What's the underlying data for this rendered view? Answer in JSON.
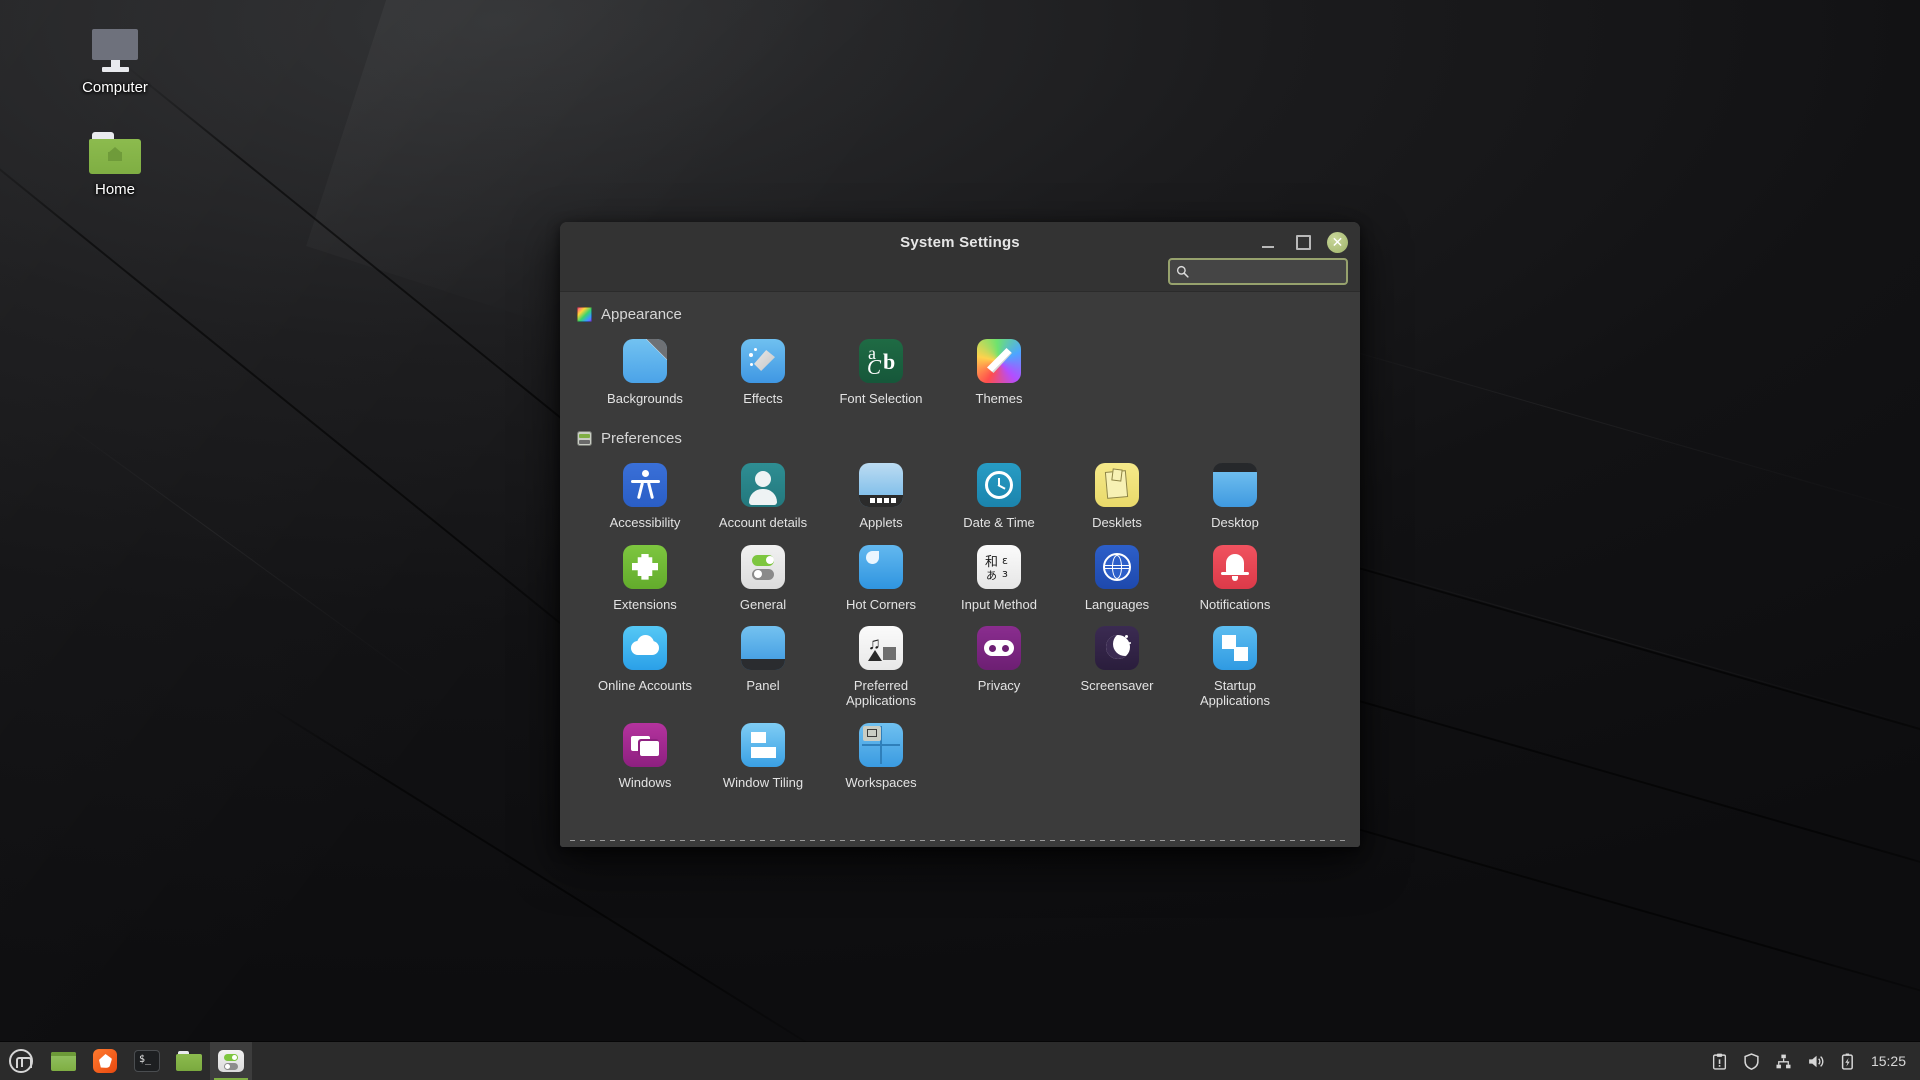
{
  "desktop": {
    "icons": [
      {
        "label": "Computer",
        "icon": "computer-monitor-icon"
      },
      {
        "label": "Home",
        "icon": "home-folder-icon"
      }
    ]
  },
  "window": {
    "title": "System Settings",
    "controls": {
      "minimize": "–",
      "maximize": "□",
      "close": "✕"
    },
    "search": {
      "value": "",
      "placeholder": "",
      "search_icon": "magnifier-icon",
      "clear_icon": "clear-backspace-icon"
    }
  },
  "sections": [
    {
      "id": "appearance",
      "title": "Appearance",
      "icon": "color-palette-icon",
      "items": [
        {
          "label": "Backgrounds",
          "icon": "backgrounds-icon",
          "tile": "t-bg"
        },
        {
          "label": "Effects",
          "icon": "magic-wand-icon",
          "tile": "t-fx"
        },
        {
          "label": "Font Selection",
          "icon": "font-abc-icon",
          "tile": "t-font"
        },
        {
          "label": "Themes",
          "icon": "paintbrush-icon",
          "tile": "t-theme"
        }
      ]
    },
    {
      "id": "preferences",
      "title": "Preferences",
      "icon": "sliders-panel-icon",
      "items": [
        {
          "label": "Accessibility",
          "icon": "accessibility-person-icon",
          "tile": "t-acc"
        },
        {
          "label": "Account details",
          "icon": "user-avatar-icon",
          "tile": "t-acct"
        },
        {
          "label": "Applets",
          "icon": "applets-panel-icon",
          "tile": "t-applets"
        },
        {
          "label": "Date & Time",
          "icon": "clock-icon",
          "tile": "t-clock"
        },
        {
          "label": "Desklets",
          "icon": "sticky-note-icon",
          "tile": "t-desk"
        },
        {
          "label": "Desktop",
          "icon": "desktop-screen-icon",
          "tile": "t-dtop"
        },
        {
          "label": "Extensions",
          "icon": "puzzle-piece-icon",
          "tile": "t-ext"
        },
        {
          "label": "General",
          "icon": "toggle-switches-icon",
          "tile": "t-gen"
        },
        {
          "label": "Hot Corners",
          "icon": "corner-icon",
          "tile": "t-hot"
        },
        {
          "label": "Input Method",
          "icon": "input-method-cjk-icon",
          "tile": "t-im"
        },
        {
          "label": "Languages",
          "icon": "globe-languages-icon",
          "tile": "t-lang"
        },
        {
          "label": "Notifications",
          "icon": "bell-icon",
          "tile": "t-note"
        },
        {
          "label": "Online Accounts",
          "icon": "cloud-icon",
          "tile": "t-cloud"
        },
        {
          "label": "Panel",
          "icon": "panel-bar-icon",
          "tile": "t-panel"
        },
        {
          "label": "Preferred Applications",
          "icon": "media-note-icon",
          "tile": "t-pref"
        },
        {
          "label": "Privacy",
          "icon": "mask-icon",
          "tile": "t-priv"
        },
        {
          "label": "Screensaver",
          "icon": "moon-stars-icon",
          "tile": "t-ssv"
        },
        {
          "label": "Startup Applications",
          "icon": "startup-squares-icon",
          "tile": "t-start"
        },
        {
          "label": "Windows",
          "icon": "windows-stack-icon",
          "tile": "t-win"
        },
        {
          "label": "Window Tiling",
          "icon": "window-tiling-icon",
          "tile": "t-tile"
        },
        {
          "label": "Workspaces",
          "icon": "workspaces-grid-icon",
          "tile": "t-wsp"
        }
      ]
    }
  ],
  "panel": {
    "launchers": [
      {
        "name": "menu",
        "icon": "mint-menu-icon",
        "active": false
      },
      {
        "name": "show-desktop",
        "icon": "green-window-icon",
        "active": false
      },
      {
        "name": "firefox",
        "icon": "firefox-icon",
        "active": false
      },
      {
        "name": "terminal",
        "icon": "terminal-icon",
        "active": false
      },
      {
        "name": "files",
        "icon": "file-manager-icon",
        "active": false
      },
      {
        "name": "system-settings",
        "icon": "system-settings-icon",
        "active": true
      }
    ],
    "tray": [
      {
        "name": "update-manager",
        "icon": "clipboard-alert-icon"
      },
      {
        "name": "firewall",
        "icon": "shield-icon"
      },
      {
        "name": "network",
        "icon": "network-icon"
      },
      {
        "name": "volume",
        "icon": "speaker-icon"
      },
      {
        "name": "battery",
        "icon": "battery-charging-icon"
      }
    ],
    "clock": "15:25"
  },
  "colors": {
    "accent": "#7fae43",
    "window_bg": "#3b3b3b",
    "titlebar_bg": "#333333",
    "panel_bg": "#2b2b2b",
    "text": "#e3e3e3",
    "search_focus_ring": "#97a26d"
  }
}
